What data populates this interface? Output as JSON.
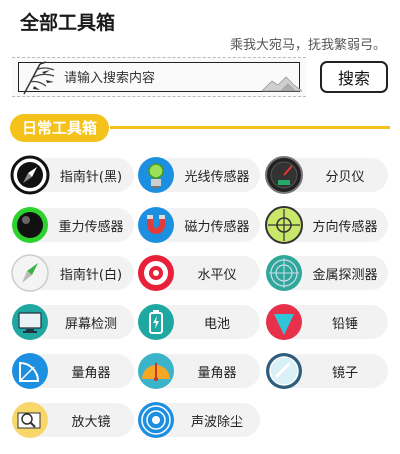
{
  "header": {
    "title": "全部工具箱",
    "slogan": "乘我大宛马，抚我繁弱弓。"
  },
  "search": {
    "placeholder": "请输入搜索内容",
    "button_label": "搜索"
  },
  "section": {
    "title": "日常工具箱",
    "accent_color": "#f4c21a"
  },
  "tools": [
    {
      "label": "指南针(黑)",
      "icon": "compass-dark-icon"
    },
    {
      "label": "光线传感器",
      "icon": "light-sensor-icon"
    },
    {
      "label": "分贝仪",
      "icon": "decibel-meter-icon"
    },
    {
      "label": "重力传感器",
      "icon": "gravity-sensor-icon"
    },
    {
      "label": "磁力传感器",
      "icon": "magnet-icon"
    },
    {
      "label": "方向传感器",
      "icon": "crosshair-icon"
    },
    {
      "label": "指南针(白)",
      "icon": "compass-white-icon"
    },
    {
      "label": "水平仪",
      "icon": "level-target-icon"
    },
    {
      "label": "金属探测器",
      "icon": "metal-detector-icon"
    },
    {
      "label": "屏幕检测",
      "icon": "monitor-icon"
    },
    {
      "label": "电池",
      "icon": "battery-icon"
    },
    {
      "label": "铅锤",
      "icon": "plumb-bob-icon"
    },
    {
      "label": "量角器",
      "icon": "protractor-blue-icon"
    },
    {
      "label": "量角器",
      "icon": "protractor-orange-icon"
    },
    {
      "label": "镜子",
      "icon": "mirror-icon"
    },
    {
      "label": "放大镜",
      "icon": "magnifier-icon"
    },
    {
      "label": "声波除尘",
      "icon": "sound-wave-icon"
    }
  ]
}
